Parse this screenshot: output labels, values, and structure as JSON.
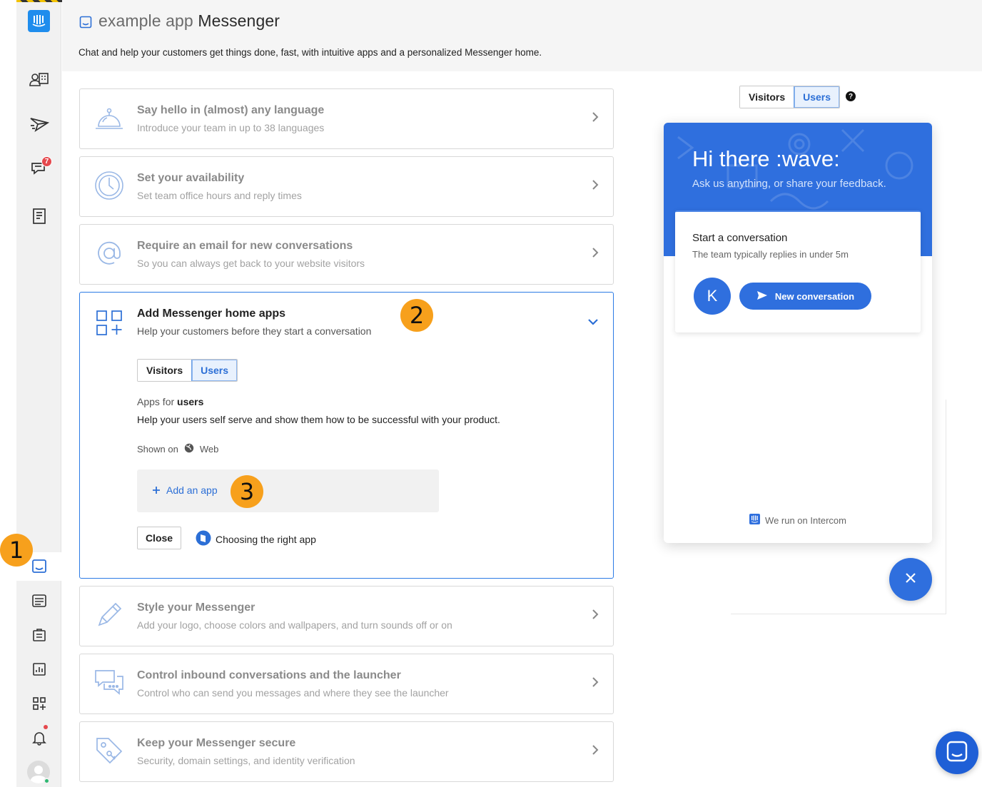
{
  "header": {
    "title_prefix": "example app",
    "title": "Messenger",
    "description": "Chat and help your customers get things done, fast, with intuitive apps and a personalized Messenger home."
  },
  "sidebar": {
    "badge_count": "7",
    "items": [
      "contacts-icon",
      "outbound-icon",
      "inbox-icon",
      "articles-icon",
      "messenger-icon",
      "operator-icon",
      "reports-icon",
      "apps-icon",
      "notifications-icon"
    ]
  },
  "cards": [
    {
      "title": "Say hello in (almost) any language",
      "subtitle": "Introduce your team in up to 38 languages",
      "icon": "bell-icon"
    },
    {
      "title": "Set your availability",
      "subtitle": "Set team office hours and reply times",
      "icon": "clock-icon"
    },
    {
      "title": "Require an email for new conversations",
      "subtitle": "So you can always get back to your website visitors",
      "icon": "at-icon"
    },
    {
      "title": "Add Messenger home apps",
      "subtitle": "Help your customers before they start a conversation",
      "icon": "apps-grid-icon"
    },
    {
      "title": "Style your Messenger",
      "subtitle": "Add your logo, choose colors and wallpapers, and turn sounds off or on",
      "icon": "pencil-icon"
    },
    {
      "title": "Control inbound conversations and the launcher",
      "subtitle": "Control who can send you messages and where they see the launcher",
      "icon": "chat-bubbles-icon"
    },
    {
      "title": "Keep your Messenger secure",
      "subtitle": "Security, domain settings, and identity verification",
      "icon": "tag-key-icon"
    }
  ],
  "expanded": {
    "tabs": [
      "Visitors",
      "Users"
    ],
    "selected_tab": "Users",
    "apps_for_prefix": "Apps for",
    "apps_for_audience": "users",
    "apps_description": "Help your users self serve and show them how to be successful with your product.",
    "shown_on_label": "Shown on",
    "shown_on_value": "Web",
    "add_app_label": "Add an app",
    "close_label": "Close",
    "help_link_label": "Choosing the right app"
  },
  "preview": {
    "tabs": [
      "Visitors",
      "Users"
    ],
    "selected_tab": "Users",
    "help_symbol": "?",
    "greeting": "Hi there :wave:",
    "intro": "Ask us anything, or share your feedback.",
    "card_title": "Start a conversation",
    "card_subtitle": "The team typically replies in under 5m",
    "avatar_letter": "K",
    "button_label": "New conversation",
    "footer": "We run on Intercom"
  },
  "markers": [
    "1",
    "2",
    "3"
  ],
  "colors": {
    "accent": "#2f6fde",
    "marker": "#f7a01c",
    "badge": "#e5484d",
    "online": "#2eb872"
  }
}
